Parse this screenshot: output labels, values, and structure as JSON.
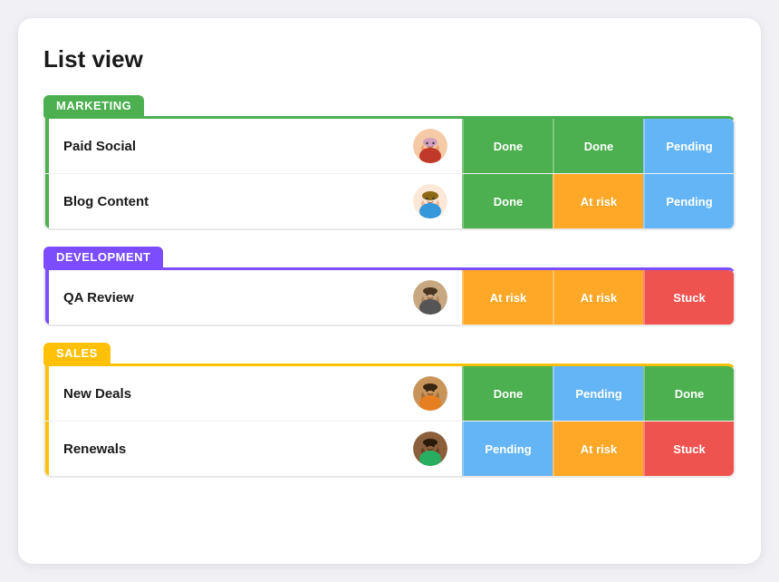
{
  "title": "List view",
  "groups": [
    {
      "id": "marketing",
      "label": "MARKETING",
      "color": "#4caf50",
      "accent_class": "group-marketing",
      "rows": [
        {
          "name": "Paid Social",
          "avatar_type": "female1",
          "statuses": [
            {
              "label": "Done",
              "type": "done"
            },
            {
              "label": "Done",
              "type": "done"
            },
            {
              "label": "Pending",
              "type": "pending"
            }
          ]
        },
        {
          "name": "Blog Content",
          "avatar_type": "female2",
          "statuses": [
            {
              "label": "Done",
              "type": "done"
            },
            {
              "label": "At risk",
              "type": "at-risk"
            },
            {
              "label": "Pending",
              "type": "pending"
            }
          ]
        }
      ]
    },
    {
      "id": "development",
      "label": "DEVELOPMENT",
      "color": "#7c4dff",
      "accent_class": "group-development",
      "rows": [
        {
          "name": "QA Review",
          "avatar_type": "male1",
          "statuses": [
            {
              "label": "At risk",
              "type": "at-risk"
            },
            {
              "label": "At risk",
              "type": "at-risk"
            },
            {
              "label": "Stuck",
              "type": "stuck"
            }
          ]
        }
      ]
    },
    {
      "id": "sales",
      "label": "SALES",
      "color": "#ffc107",
      "accent_class": "group-sales",
      "rows": [
        {
          "name": "New Deals",
          "avatar_type": "male2",
          "statuses": [
            {
              "label": "Done",
              "type": "done"
            },
            {
              "label": "Pending",
              "type": "pending"
            },
            {
              "label": "Done",
              "type": "done"
            }
          ]
        },
        {
          "name": "Renewals",
          "avatar_type": "male3",
          "statuses": [
            {
              "label": "Pending",
              "type": "pending"
            },
            {
              "label": "At risk",
              "type": "at-risk"
            },
            {
              "label": "Stuck",
              "type": "stuck"
            }
          ]
        }
      ]
    }
  ]
}
